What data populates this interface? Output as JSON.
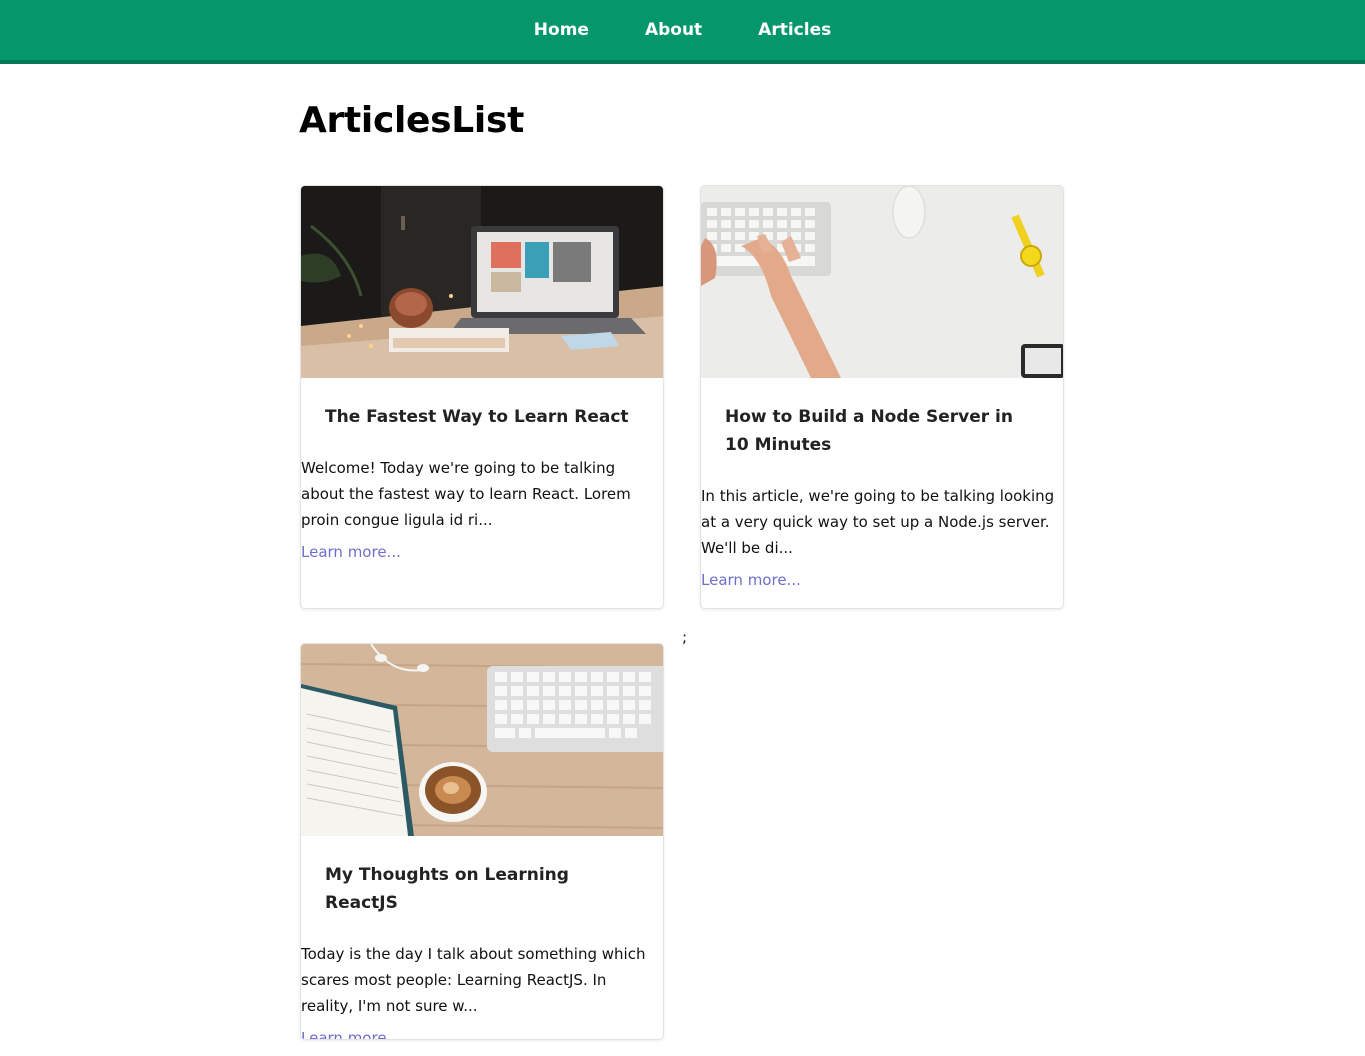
{
  "nav": {
    "items": [
      {
        "label": "Home"
      },
      {
        "label": "About"
      },
      {
        "label": "Articles"
      }
    ],
    "bg_color": "#05976b"
  },
  "page": {
    "title": "ArticlesList",
    "stray_text": ";"
  },
  "articles": [
    {
      "title": "The Fastest Way to Learn React",
      "excerpt": "Welcome! Today we're going to be talking about the fastest way to learn React. Lorem proin congue ligula id ri...",
      "link_label": "Learn more...",
      "image_desc": "laptop-on-desk-image"
    },
    {
      "title": "How to Build a Node Server in 10 Minutes",
      "excerpt": "In this article, we're going to be talking looking at a very quick way to set up a Node.js server. We'll be di...",
      "link_label": "Learn more...",
      "image_desc": "hands-typing-keyboard-image"
    },
    {
      "title": "My Thoughts on Learning ReactJS",
      "excerpt": "Today is the day I talk about something which scares most people: Learning ReactJS. In reality, I'm not sure w...",
      "link_label": "Learn more...",
      "image_desc": "notebook-coffee-keyboard-image"
    }
  ],
  "colors": {
    "link": "#6e6ecc",
    "nav_border": "#037a55"
  }
}
